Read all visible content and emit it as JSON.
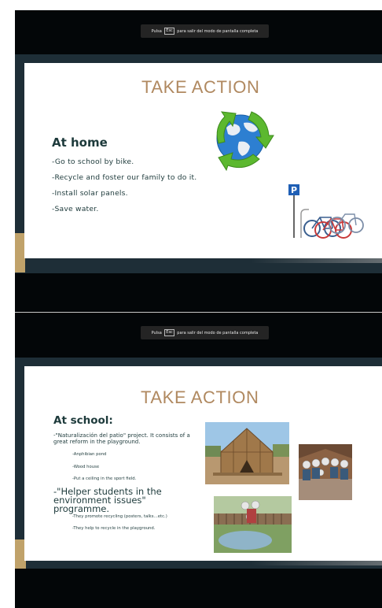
{
  "screens": [
    {
      "toast": {
        "pre": "Pulsa",
        "key": "Esc",
        "post": "para salir del modo de pantalla completa"
      },
      "slide": {
        "title": "TAKE ACTION",
        "heading": "At home",
        "lines": [
          "-Go to school by bike.",
          "-Recycle and foster our family to do it.",
          "-Install solar panels.",
          "-Save water."
        ],
        "parking_sign": "P"
      }
    },
    {
      "toast": {
        "pre": "Pulsa",
        "key": "Esc",
        "post": "para salir del modo de pantalla completa"
      },
      "slide": {
        "title": "TAKE ACTION",
        "heading": "At school:",
        "paragraph": "-\"Naturalización del patio\" project.  It consists of a great reform in the playground.",
        "subitems": [
          "-Anphibian pond",
          "-Wood house",
          "-Put a ceiling in the sport field."
        ],
        "programme": "-\"Helper students in the environment issues\" programme.",
        "programme_items": [
          "-They promote recycling (posters, talks…etc.)",
          "-They help to recycle in the playground."
        ]
      }
    }
  ],
  "colors": {
    "band": "#1e2e37",
    "gold": "#c0a26a",
    "title": "#b08960",
    "text": "#1d3a3b"
  }
}
